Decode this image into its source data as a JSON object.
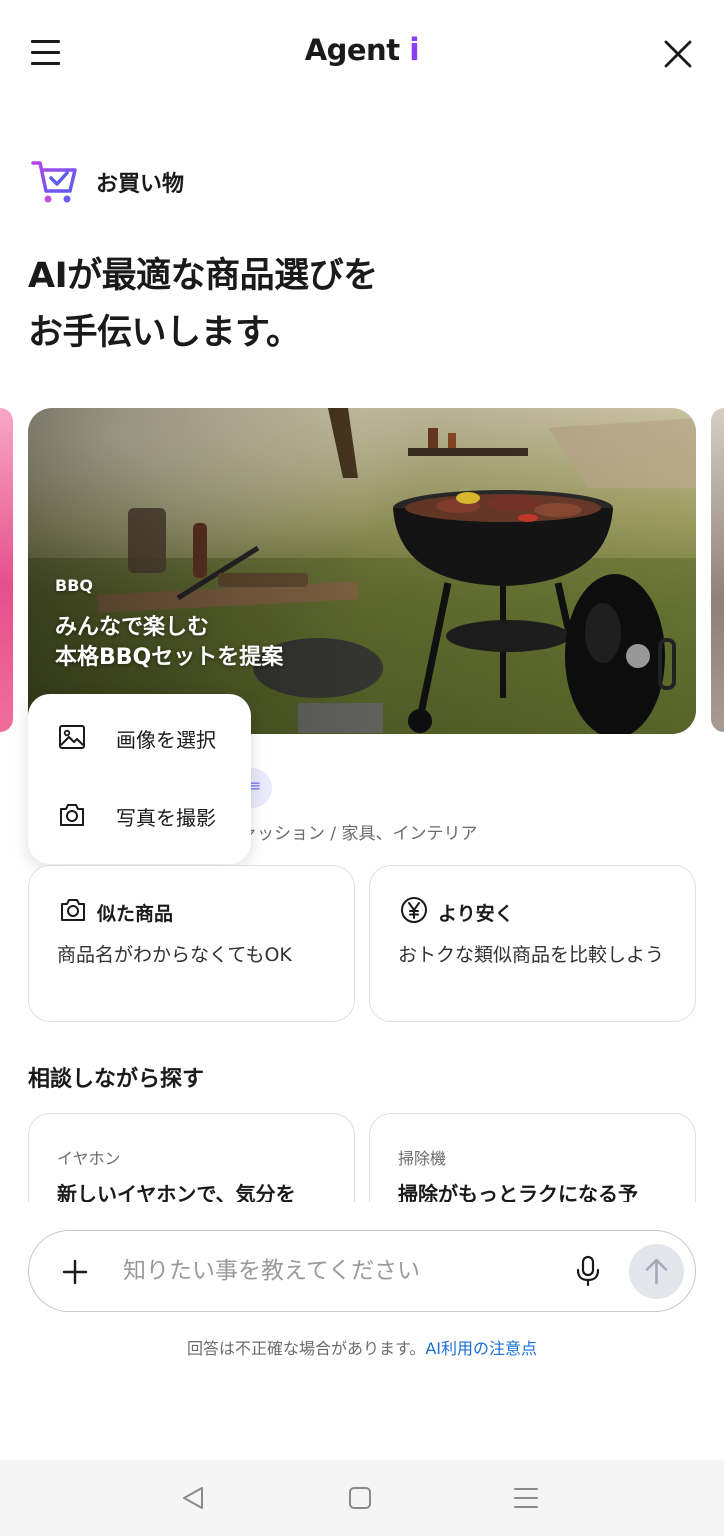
{
  "header": {
    "logo_text": "Agent ",
    "logo_accent": "i",
    "logo_accent_color": "#8b3ff5"
  },
  "category": {
    "label": "お買い物",
    "icon": "shopping-cart-check-icon"
  },
  "headline": {
    "line1": "AIが最適な商品選びを",
    "line2": "お手伝いします。"
  },
  "hero": {
    "tag": "BBQ",
    "title_line1": "みんなで楽しむ",
    "title_line2": "本格BBQセットを提案"
  },
  "popup_menu": {
    "items": [
      {
        "label": "画像を選択",
        "icon": "image-icon"
      },
      {
        "label": "写真を撮影",
        "icon": "camera-icon"
      }
    ]
  },
  "category_line": "ァッション / 家具、インテリア",
  "features": [
    {
      "title": "似た商品",
      "desc": "商品名がわからなくてもOK",
      "icon": "camera-icon"
    },
    {
      "title": "より安く",
      "desc": "おトクな類似商品を比較しよう",
      "icon": "yen-icon"
    }
  ],
  "consult_section": {
    "title": "相談しながら探す",
    "cards": [
      {
        "tag": "イヤホン",
        "text": "新しいイヤホンで、気分を"
      },
      {
        "tag": "掃除機",
        "text": "掃除がもっとラクになる予"
      }
    ]
  },
  "input": {
    "placeholder": "知りたい事を教えてください"
  },
  "disclaimer": {
    "text": "回答は不正確な場合があります。",
    "link": "AI利用の注意点",
    "link_color": "#1a6ed8"
  },
  "colors": {
    "accent_purple": "#8b3ff5",
    "send_button_bg": "#e4e6ee"
  }
}
